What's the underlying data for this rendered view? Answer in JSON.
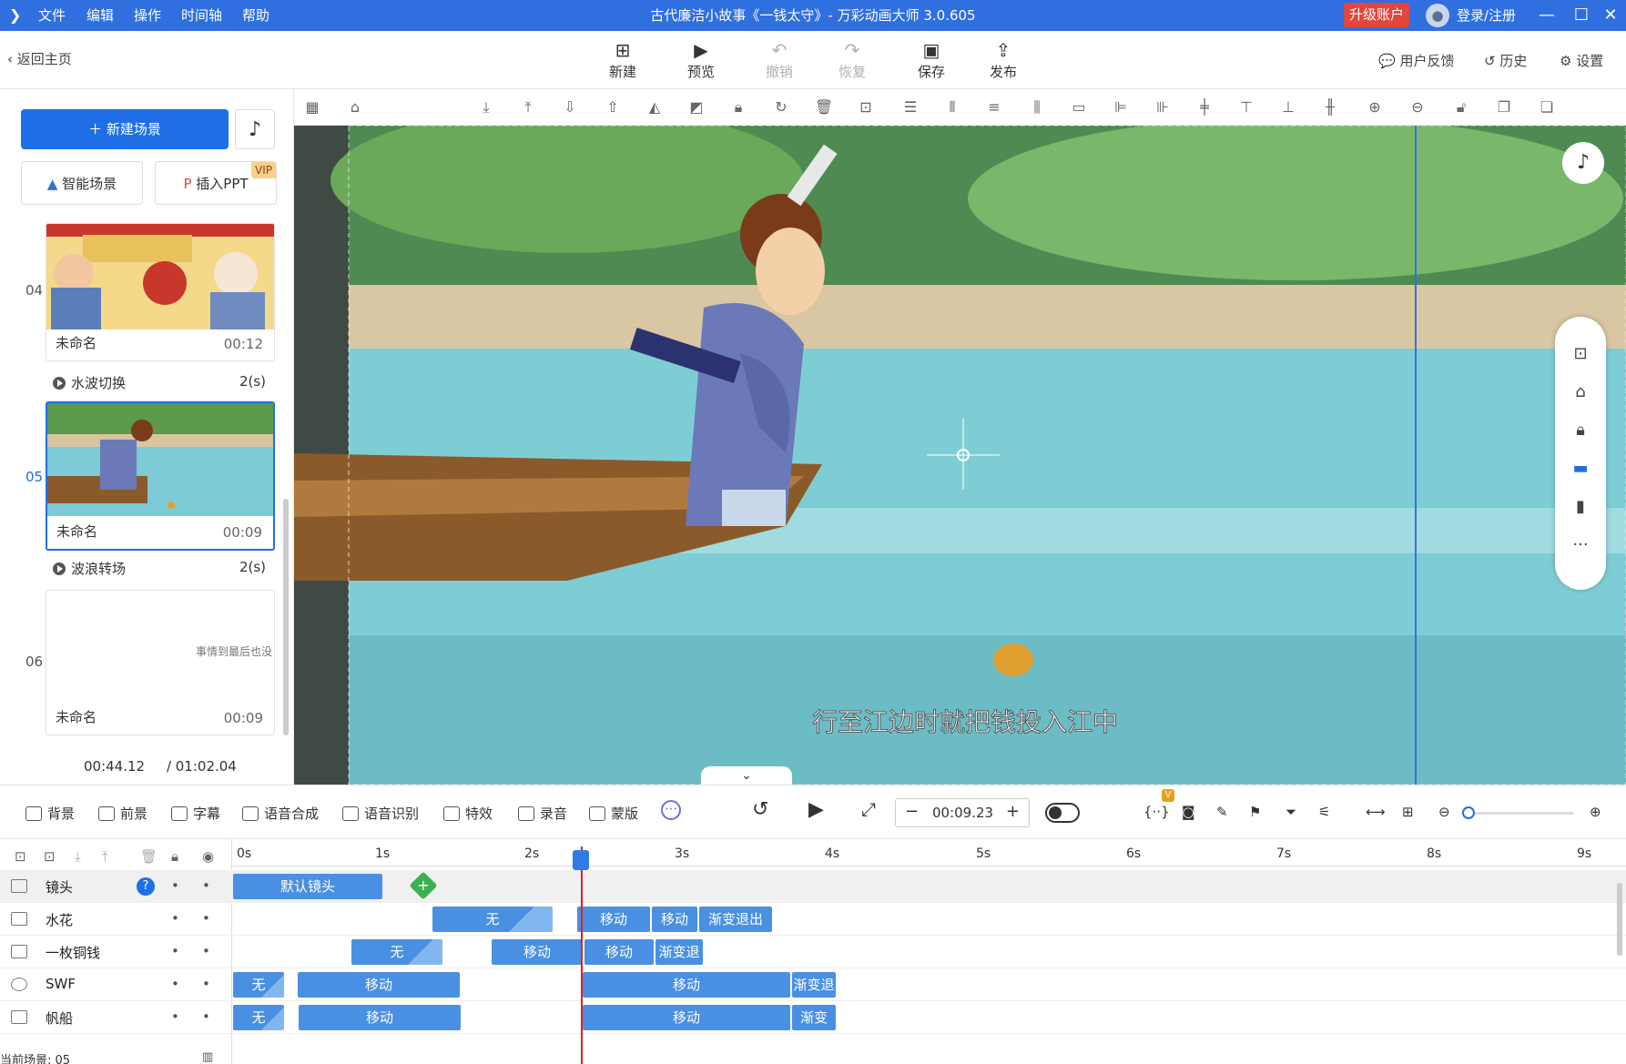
{
  "titlebar": {
    "menu": [
      "文件",
      "编辑",
      "操作",
      "时间轴",
      "帮助"
    ],
    "title": "古代廉洁小故事《一钱太守》- 万彩动画大师 3.0.605",
    "upgrade": "升级账户",
    "login": "登录/注册",
    "accent": "#2f6fe0"
  },
  "toolbar": {
    "back": "返回主页",
    "buttons": [
      "新建",
      "预览",
      "撤销",
      "恢复",
      "保存",
      "发布"
    ],
    "feedback": "用户反馈",
    "history": "历史",
    "settings": "设置"
  },
  "left": {
    "new_scene": "新建场景",
    "smart_scene": "智能场景",
    "insert_ppt": "插入PPT",
    "vip": "VIP",
    "scenes": [
      {
        "num": "04",
        "name": "未命名",
        "dur": "00:12"
      },
      {
        "num": "05",
        "name": "未命名",
        "dur": "00:09"
      },
      {
        "num": "06",
        "name": "未命名",
        "dur": "00:09",
        "text": "事情到最后也没"
      }
    ],
    "transitions": [
      {
        "name": "水波切换",
        "dur": "2(s)"
      },
      {
        "name": "波浪转场",
        "dur": "2(s)"
      }
    ],
    "time_current": "00:44.12",
    "time_total": "/ 01:02.04"
  },
  "stage": {
    "subtitle": "行至江边时就把钱投入江中"
  },
  "controls": {
    "items": [
      "背景",
      "前景",
      "字幕",
      "语音合成",
      "语音识别",
      "特效",
      "录音",
      "蒙版"
    ],
    "time": "00:09.23",
    "vbadge": "V"
  },
  "timeline": {
    "ticks": [
      "0s",
      "1s",
      "2s",
      "3s",
      "4s",
      "5s",
      "6s",
      "7s",
      "8s",
      "9s"
    ],
    "current_scene": "当前场景: 05",
    "layers": [
      {
        "name": "镜头",
        "clips": [
          "默认镜头"
        ]
      },
      {
        "name": "水花",
        "clips": [
          "无",
          "移动",
          "移动",
          "渐变退出"
        ]
      },
      {
        "name": "一枚铜钱",
        "clips": [
          "无",
          "移动",
          "移动",
          "渐变退"
        ]
      },
      {
        "name": "SWF",
        "clips": [
          "无",
          "移动",
          "移动",
          "渐变退"
        ]
      },
      {
        "name": "帆船",
        "clips": [
          "无",
          "移动",
          "移动",
          "渐变"
        ]
      }
    ]
  }
}
